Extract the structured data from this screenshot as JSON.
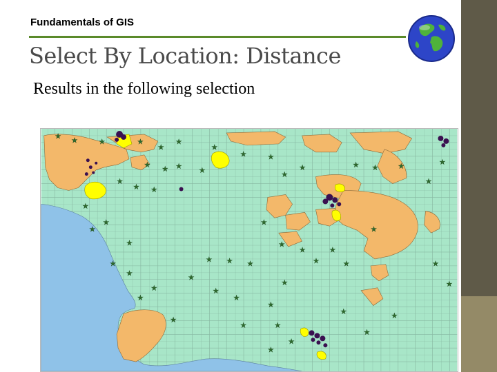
{
  "header": {
    "course_label": "Fundamentals of GIS"
  },
  "slide": {
    "title": "Select By Location: Distance",
    "subtitle": "Results in the following selection"
  },
  "icons": {
    "globe": "globe-icon"
  },
  "colors": {
    "rule": "#5a8a2a",
    "sidebar": "#5f5a48",
    "sidebar_accent": "#948a67",
    "map_land": "#a8e6c8",
    "map_water": "#8fc2e8",
    "map_polygons": "#f3b86a",
    "selected_features": "#ffff00",
    "selected_points": "#3a1050",
    "star_markers": "#2e6b2e"
  },
  "map": {
    "layers": [
      "tracts",
      "orange-regions",
      "selected-yellow",
      "selected-purple",
      "star-points",
      "ocean"
    ]
  }
}
